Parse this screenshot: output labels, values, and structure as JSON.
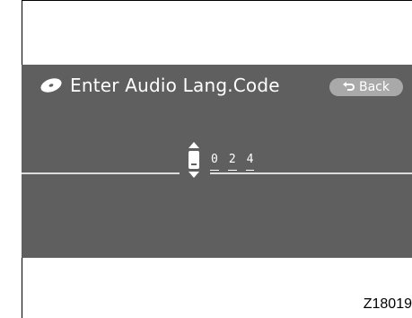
{
  "screen": {
    "title": "Enter Audio Lang.Code",
    "back_label": "Back",
    "code_digits": [
      "0",
      "2",
      "4"
    ],
    "background_color": "#5f5f5f",
    "back_button_color": "#a9a9a9",
    "title_icon": "disc-icon",
    "back_icon": "return-arrow-icon",
    "stepper_icon": "up-down-stepper-icon"
  },
  "figure_code": "Z18019"
}
